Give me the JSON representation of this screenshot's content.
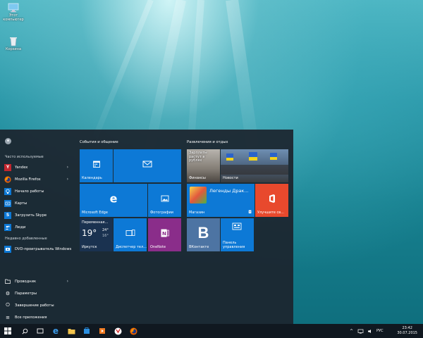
{
  "desktop": {
    "icons": [
      {
        "label_1": "Этот",
        "label_2": "компьютер",
        "icon": "computer-icon"
      },
      {
        "label_1": "Корзина",
        "icon": "recycle-bin-icon"
      }
    ]
  },
  "start": {
    "most_used_header": "Часто используемые",
    "apps": [
      {
        "label": "Yandex",
        "icon": "yandex-icon",
        "has_arrow": true
      },
      {
        "label": "Mozilla Firefox",
        "icon": "firefox-icon",
        "has_arrow": true
      },
      {
        "label": "Начало работы",
        "icon": "lightbulb-icon"
      },
      {
        "label": "Карты",
        "icon": "maps-icon"
      },
      {
        "label": "Загрузить Skype",
        "icon": "skype-icon"
      },
      {
        "label": "Люди",
        "icon": "people-icon"
      }
    ],
    "recent_header": "Недавно добавленные",
    "recent_apps": [
      {
        "label": "DVD-проигрыватель Windows",
        "icon": "dvd-icon"
      }
    ],
    "system": [
      {
        "label": "Проводник",
        "icon": "folder-icon",
        "has_arrow": true
      },
      {
        "label": "Параметры",
        "icon": "gear-icon"
      },
      {
        "label": "Завершение работы",
        "icon": "power-icon"
      },
      {
        "label": "Все приложения",
        "icon": "list-icon"
      }
    ],
    "groups": {
      "left": "События и общение",
      "right": "Развлечения и отдых"
    },
    "tiles": {
      "calendar": "Календарь",
      "mail": "",
      "edge": "Microsoft Edge",
      "photos": "Фотографии",
      "weather_top": "Переменная...",
      "weather_temp": "19°",
      "weather_hi": "24°",
      "weather_lo": "16°",
      "weather_city": "Иркутск",
      "task_manager": "Диспетчер тел...",
      "onenote": "OneNote",
      "finance_text_1": "Зарплаты",
      "finance_text_2": "растут в",
      "finance_text_3": "рублях",
      "finance": "Финансы",
      "news": "Новости",
      "store_title": "Легенды Драк...",
      "store": "Магазин",
      "office": "Улучшите св...",
      "vk": "ВКонтакте",
      "control_panel_1": "Панель",
      "control_panel_2": "управления"
    }
  },
  "taskbar": {
    "lang": "РУС",
    "time": "23:42",
    "date": "30.07.2015",
    "accent": "#0d79d6"
  }
}
